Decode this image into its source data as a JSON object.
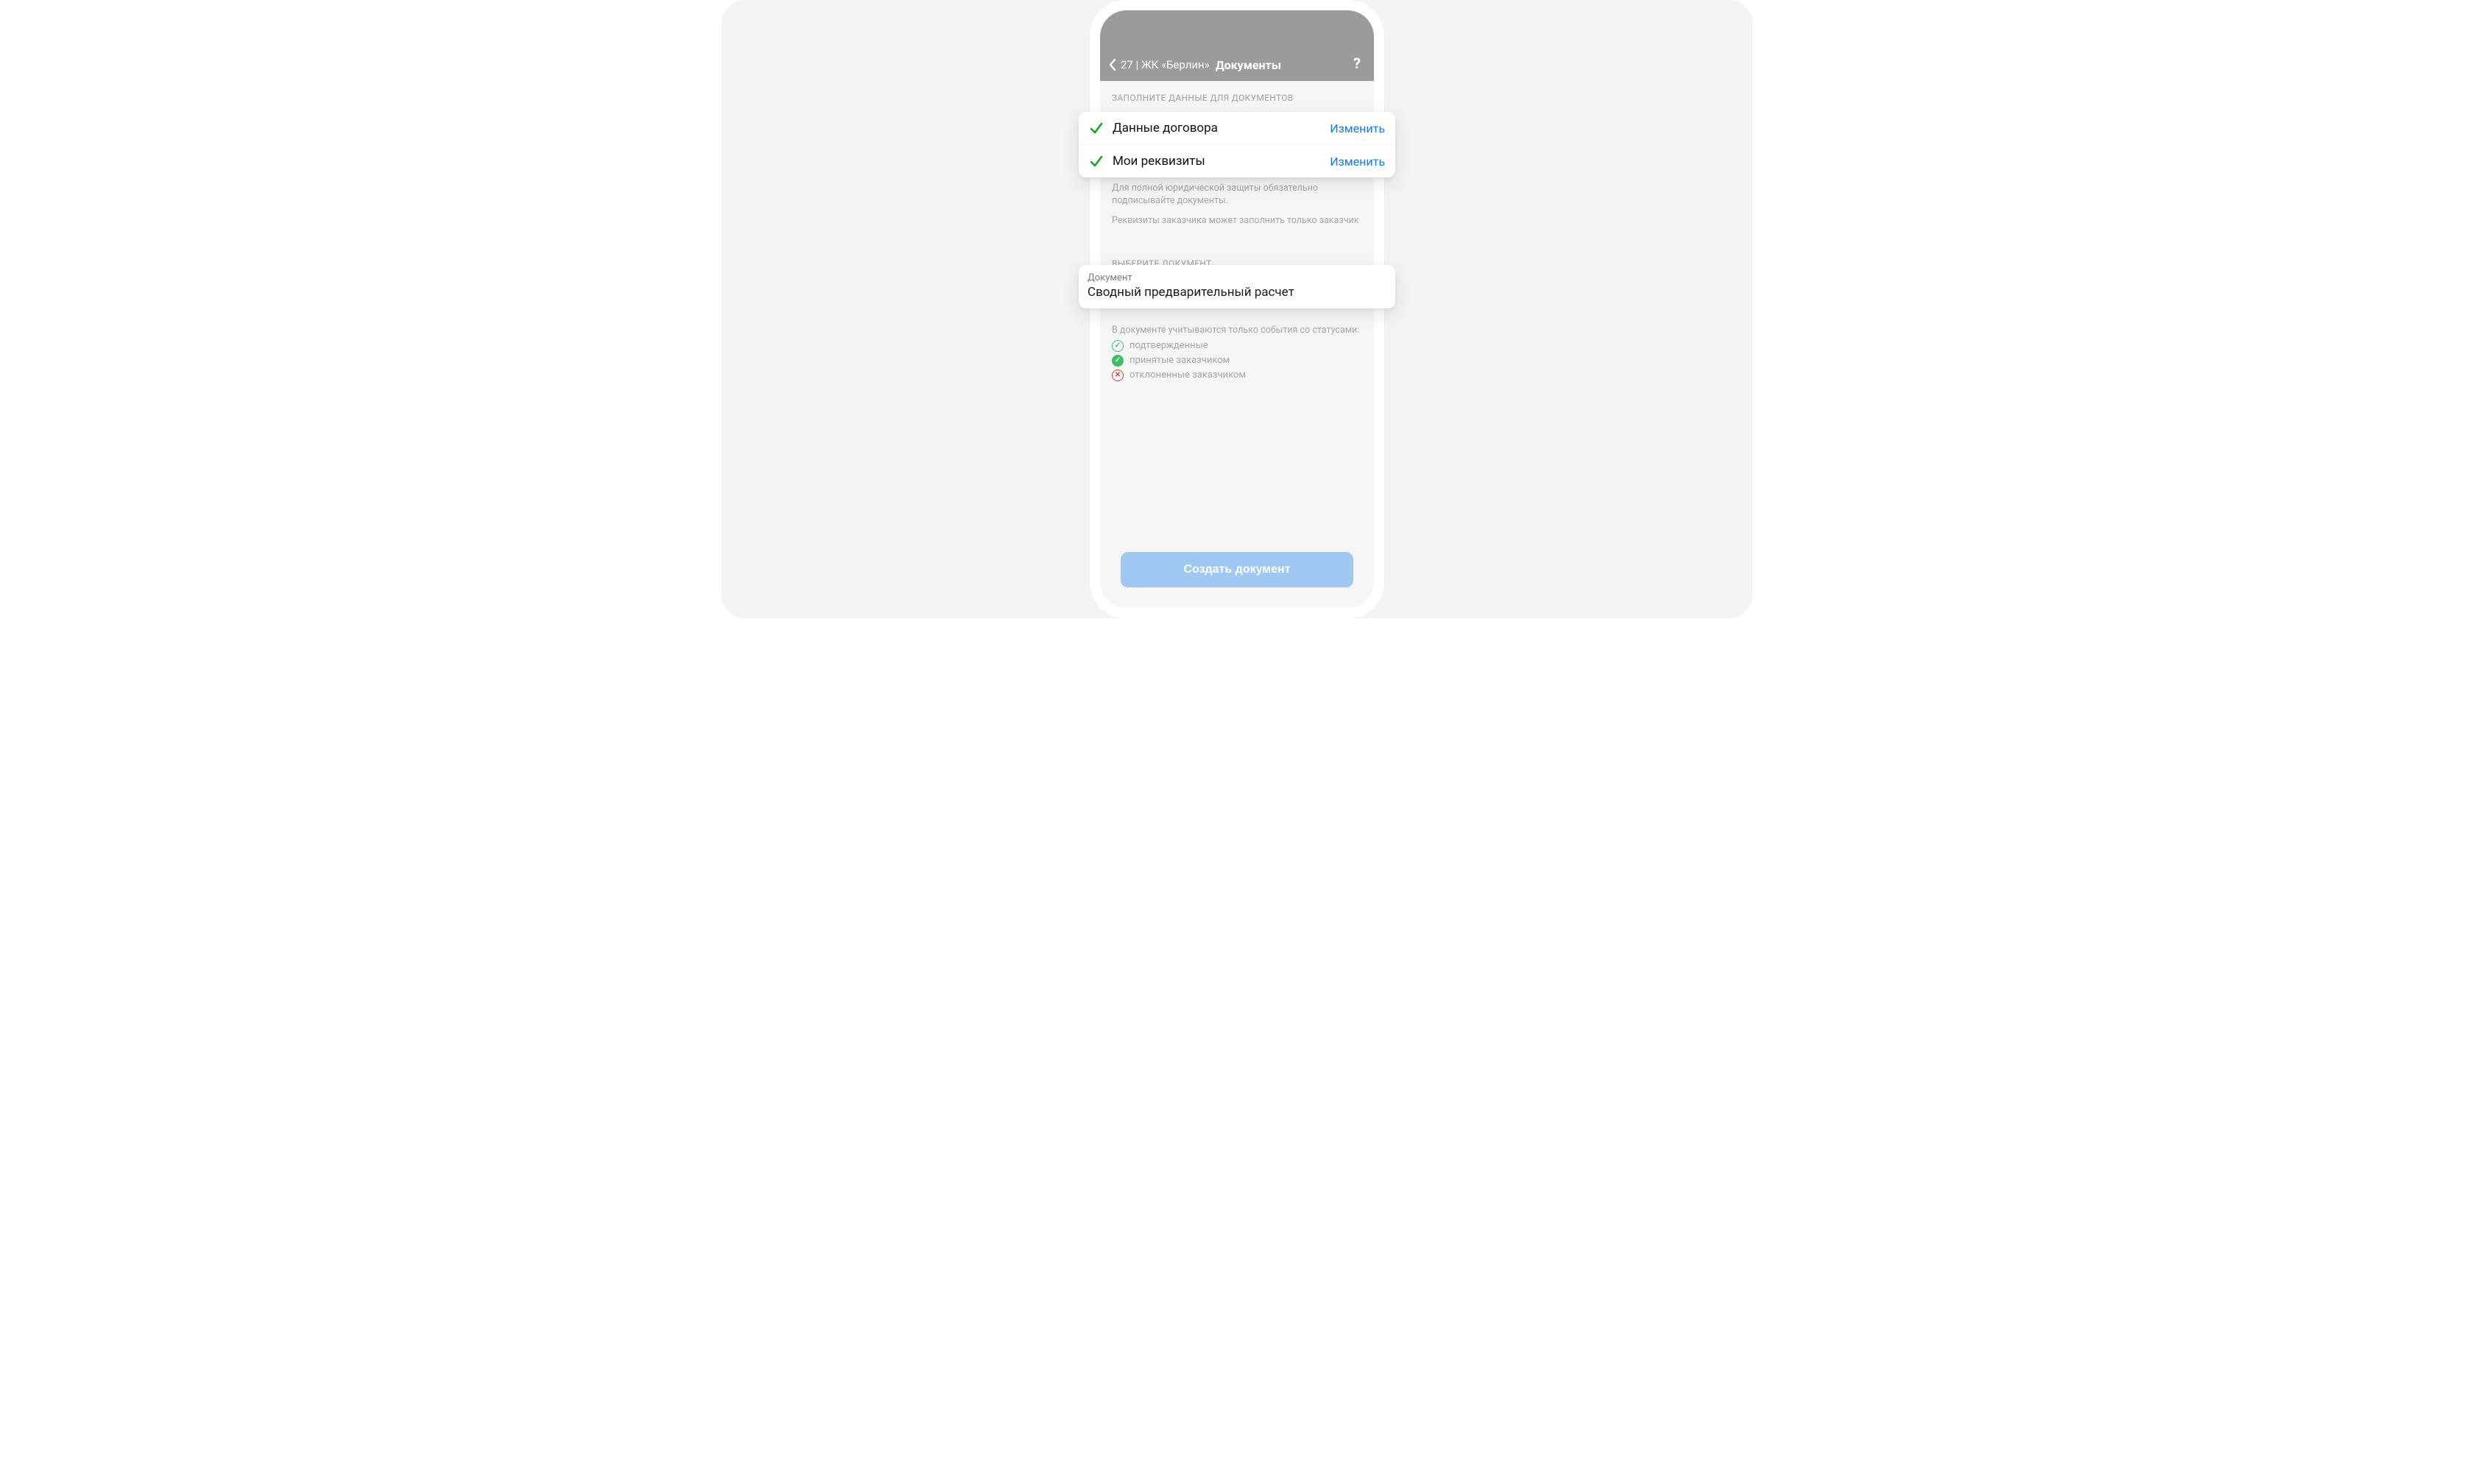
{
  "navbar": {
    "back_label": "27 | ЖК «Берлин»",
    "title": "Документы",
    "help": "?"
  },
  "sections": {
    "fill_header": "ЗАПОЛНИТЕ ДАННЫЕ ДЛЯ ДОКУМЕНТОВ",
    "select_header": "ВЫБЕРИТЕ ДОКУМЕНТ"
  },
  "rows": {
    "contract": {
      "title": "Данные договора",
      "action": "Изменить"
    },
    "requisites": {
      "title": "Мои реквизиты",
      "action": "Изменить"
    }
  },
  "captions": {
    "line1": "Для полной юридической защиты обязательно подписывайте документы.",
    "line2": "Реквизиты заказчика может заполнить только заказчик"
  },
  "document_field": {
    "label": "Документ",
    "value": "Сводный предварительный расчет"
  },
  "statuses": {
    "lead": "В документе учитываются только события со статусами:",
    "confirmed": "подтвержденные",
    "accepted": "принятые заказчиком",
    "rejected": "отклоненные заказчиком"
  },
  "cta": {
    "create": "Создать документ"
  },
  "colors": {
    "accent_blue": "#0a7aff",
    "button_blue": "#9fc8f2",
    "check_green": "#18a61f",
    "status_green": "#3bbf62",
    "status_red": "#d9453a",
    "navbar_gray": "#9b9b9b"
  }
}
